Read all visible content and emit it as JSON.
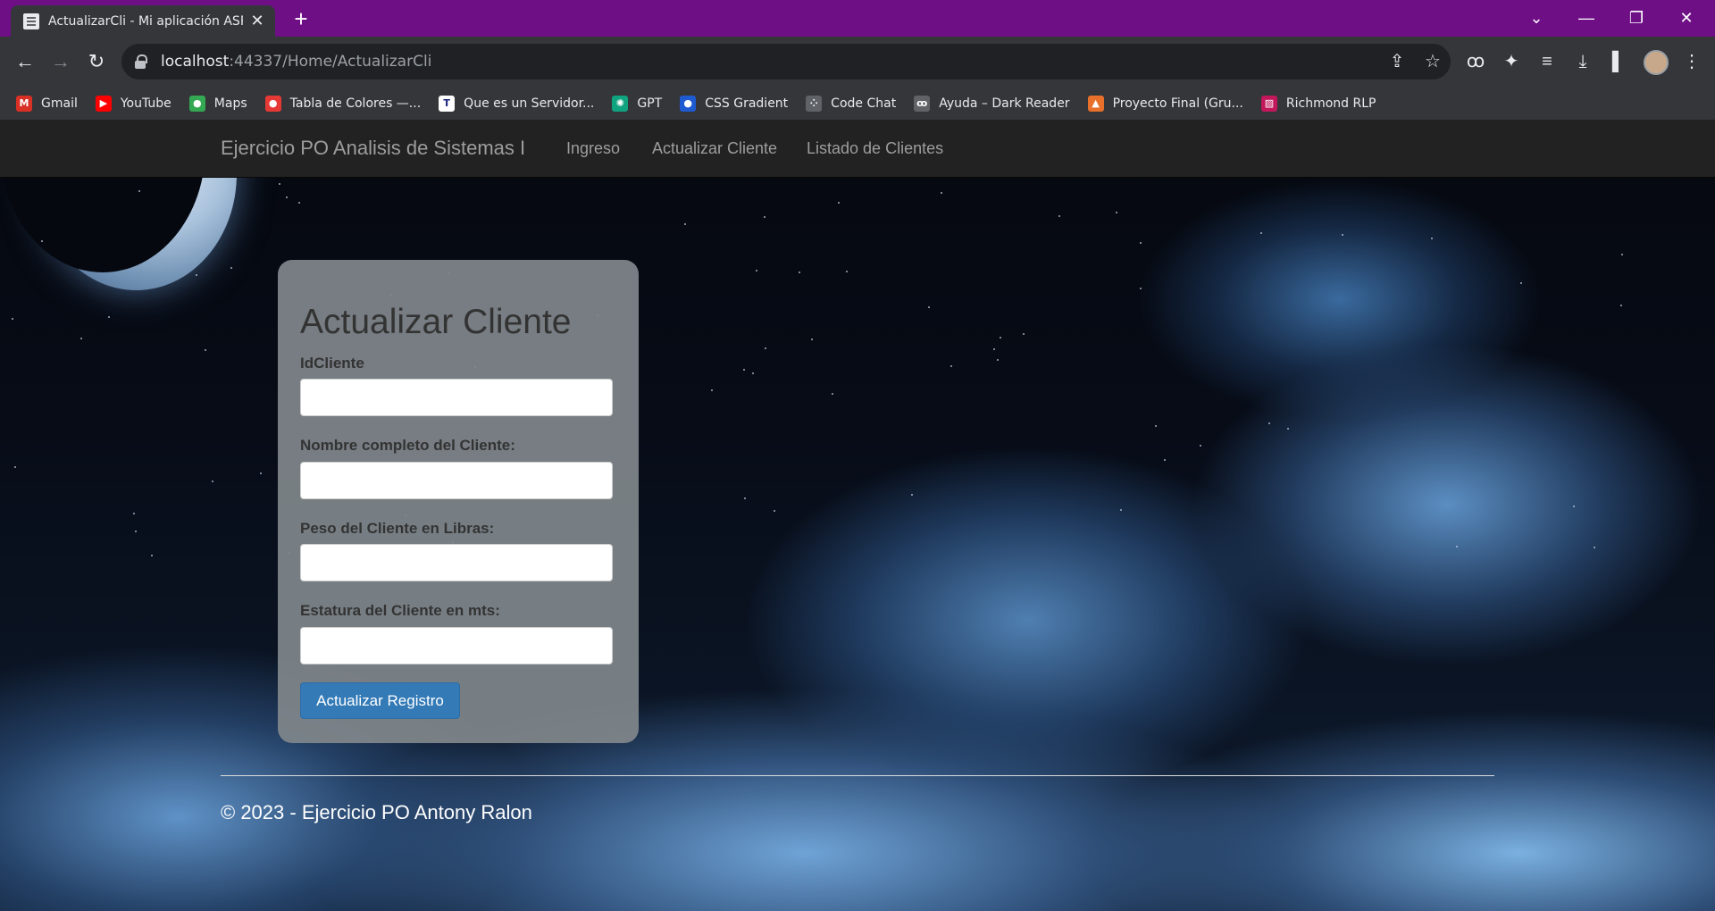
{
  "browser": {
    "tab_title": "ActualizarCli - Mi aplicación ASP.N",
    "url_host": "localhost",
    "url_rest": ":44337/Home/ActualizarCli"
  },
  "bookmarks": [
    {
      "label": "Gmail",
      "icon": "gmail-icon",
      "color": "#d93025",
      "glyph": "M"
    },
    {
      "label": "YouTube",
      "icon": "youtube-icon",
      "color": "#ff0000",
      "glyph": "▶"
    },
    {
      "label": "Maps",
      "icon": "maps-icon",
      "color": "#34a853",
      "glyph": "●"
    },
    {
      "label": "Tabla de Colores —...",
      "icon": "colors-icon",
      "color": "#e53935",
      "glyph": "●"
    },
    {
      "label": "Que es un Servidor...",
      "icon": "t-icon",
      "color": "#ffffff",
      "glyph": "T"
    },
    {
      "label": "GPT",
      "icon": "gpt-icon",
      "color": "#10a37f",
      "glyph": "✺"
    },
    {
      "label": "CSS Gradient",
      "icon": "gradient-icon",
      "color": "#1e5bd1",
      "glyph": "●"
    },
    {
      "label": "Code Chat",
      "icon": "codechat-icon",
      "color": "#5f6368",
      "glyph": "⁘"
    },
    {
      "label": "Ayuda – Dark Reader",
      "icon": "darkreader-icon",
      "color": "#5f6368",
      "glyph": "ꝏ"
    },
    {
      "label": "Proyecto Final (Gru...",
      "icon": "project-icon",
      "color": "#e8702a",
      "glyph": "▲"
    },
    {
      "label": "Richmond RLP",
      "icon": "richmond-icon",
      "color": "#c2185b",
      "glyph": "▨"
    }
  ],
  "navbar": {
    "brand": "Ejercicio PO Analisis de Sistemas I",
    "links": [
      "Ingreso",
      "Actualizar Cliente",
      "Listado de Clientes"
    ]
  },
  "form": {
    "title": "Actualizar Cliente",
    "fields": [
      {
        "label": "IdCliente",
        "value": ""
      },
      {
        "label": "Nombre completo del Cliente:",
        "value": ""
      },
      {
        "label": "Peso del Cliente en Libras:",
        "value": ""
      },
      {
        "label": "Estatura del Cliente en mts:",
        "value": ""
      }
    ],
    "submit": "Actualizar Registro"
  },
  "footer": "© 2023 - Ejercicio PO Antony Ralon"
}
